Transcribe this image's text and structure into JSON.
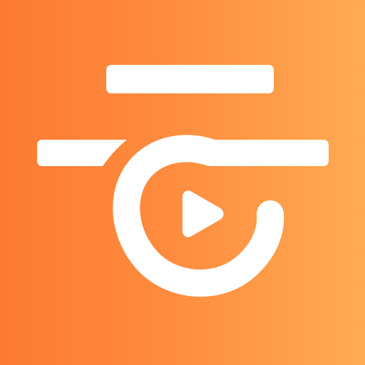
{
  "icon": {
    "name": "video-player-app-icon",
    "glyph": "play-icon",
    "colors": {
      "gradient_start": "#fd7a33",
      "gradient_mid": "#fe8b3e",
      "gradient_end": "#ffab52",
      "mark": "#ffffff"
    }
  }
}
